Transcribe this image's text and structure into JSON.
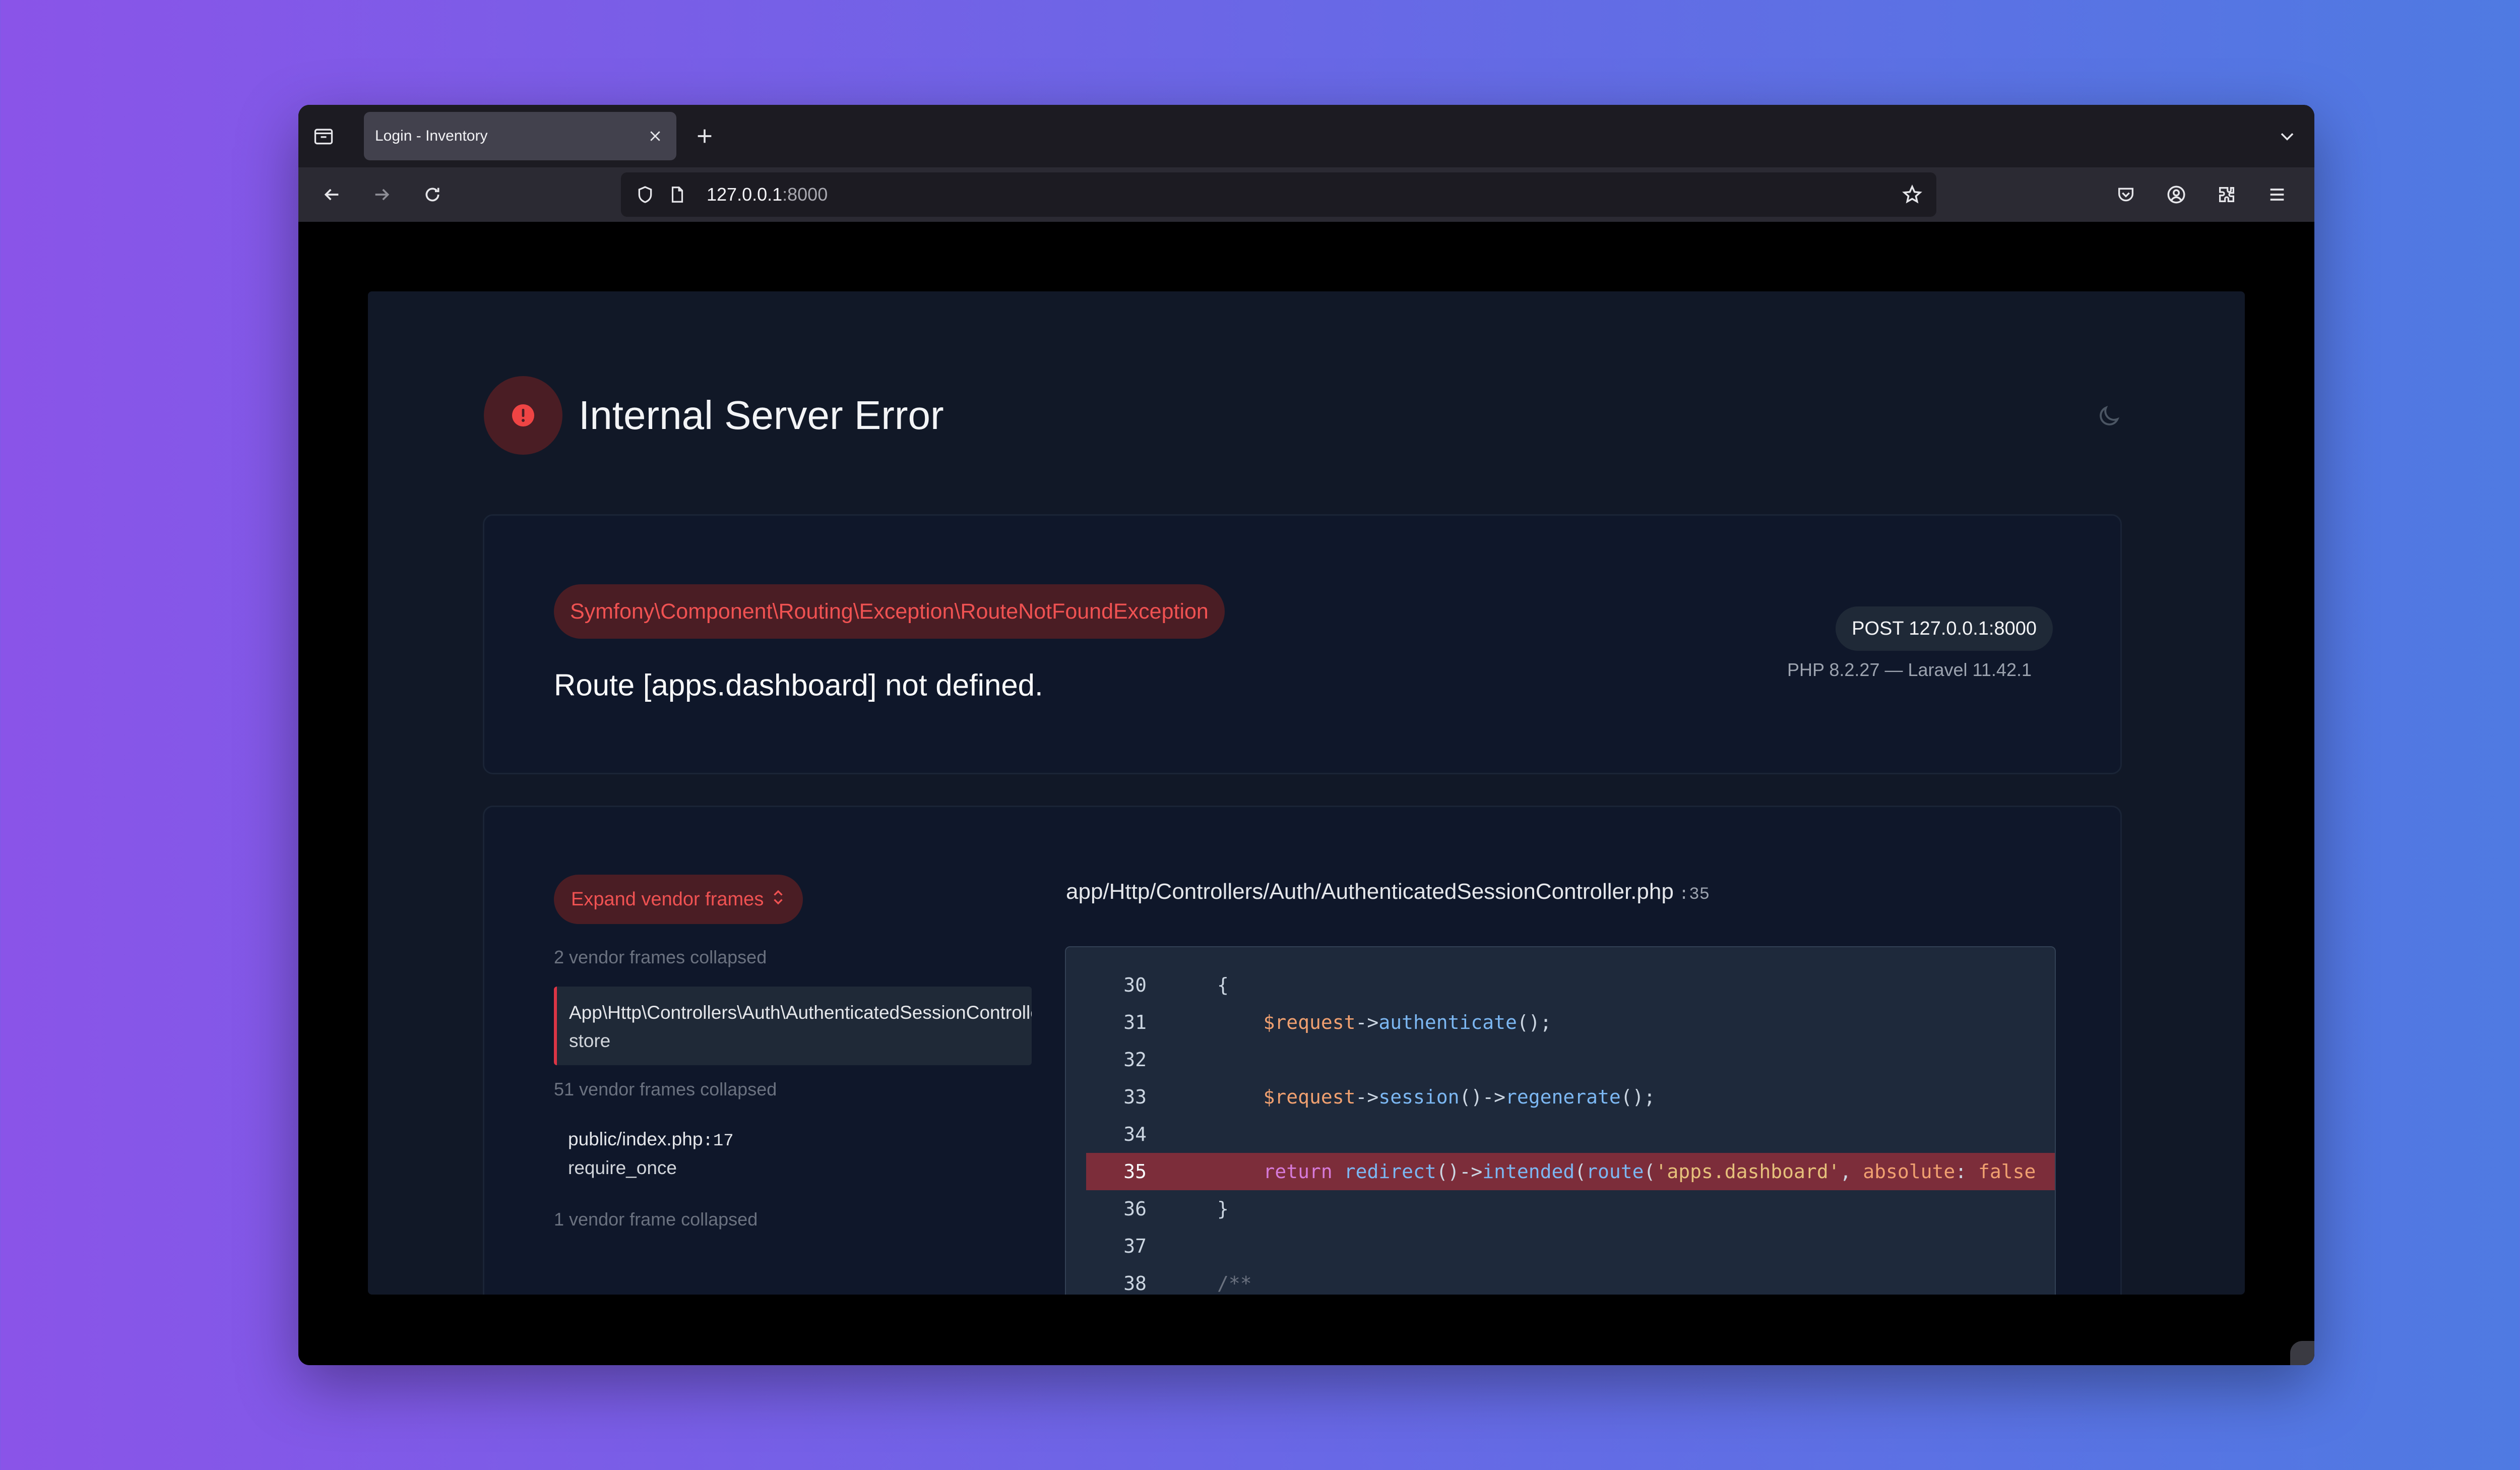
{
  "browser": {
    "tab": {
      "title": "Login - Inventory"
    },
    "url": {
      "host": "127.0.0.1",
      "port": ":8000"
    }
  },
  "page": {
    "title": "Internal Server Error",
    "exception": {
      "class": "Symfony\\Component\\Routing\\Exception\\RouteNotFoundException",
      "message": "Route [apps.dashboard] not defined.",
      "request": "POST 127.0.0.1:8000",
      "environment": "PHP 8.2.27 — Laravel 11.42.1"
    },
    "trace": {
      "expand_label": "Expand vendor frames",
      "collapsed_1": "2 vendor frames collapsed",
      "frame_1": {
        "class": "App\\Http\\Controllers\\Auth\\AuthenticatedSessionController",
        "method": "store"
      },
      "collapsed_2": "51 vendor frames collapsed",
      "frame_2": {
        "file": "public/index.php",
        "line": ":17",
        "method": "require_once"
      },
      "collapsed_3": "1 vendor frame collapsed"
    },
    "source": {
      "file": "app/Http/Controllers/Auth/AuthenticatedSessionController.php",
      "line": ":35",
      "highlighted_line": 35,
      "lines": [
        {
          "num": "30",
          "code": "{"
        },
        {
          "num": "31",
          "code": "    $request->authenticate();"
        },
        {
          "num": "32",
          "code": ""
        },
        {
          "num": "33",
          "code": "    $request->session()->regenerate();"
        },
        {
          "num": "34",
          "code": ""
        },
        {
          "num": "35",
          "code": "    return redirect()->intended(route('apps.dashboard', absolute: false"
        },
        {
          "num": "36",
          "code": "}"
        },
        {
          "num": "37",
          "code": ""
        },
        {
          "num": "38",
          "code": "/**"
        }
      ]
    }
  },
  "colors": {
    "error_accent": "#f05252",
    "highlight_line": "#7c2d3a",
    "card_background": "#111827"
  }
}
